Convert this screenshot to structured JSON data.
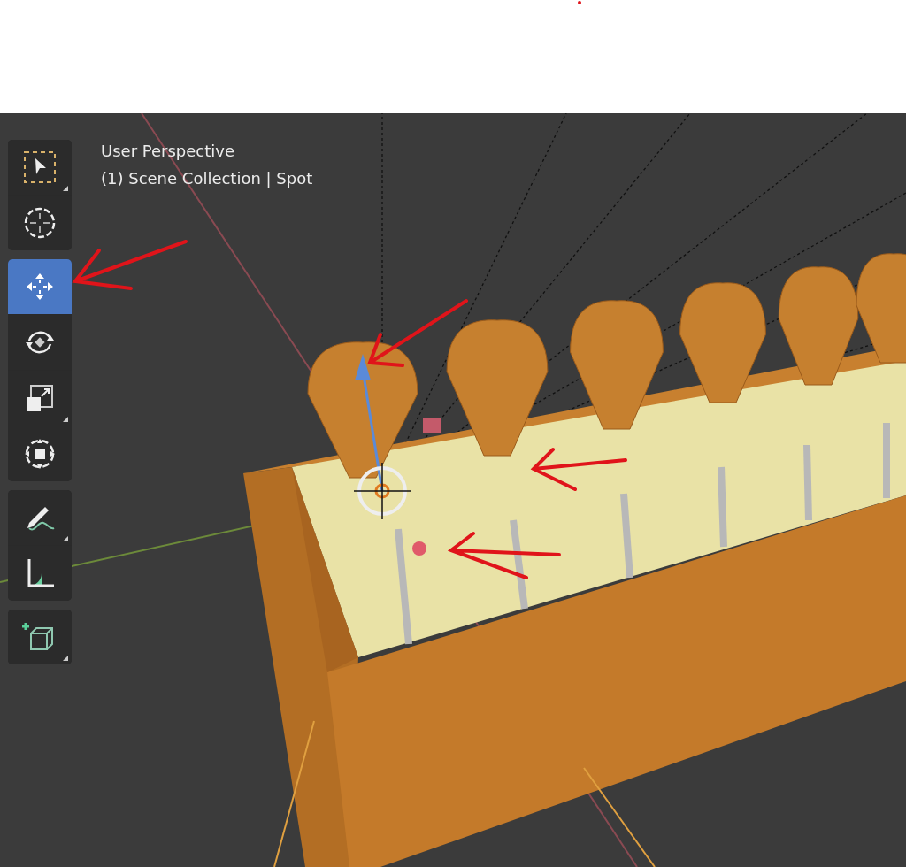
{
  "viewport": {
    "view_name": "User Perspective",
    "context": "(1) Scene Collection | Spot"
  },
  "toolbar": {
    "groups": [
      {
        "tools": [
          {
            "kind": "select",
            "selected": false,
            "submenu": true
          },
          {
            "kind": "cursor",
            "selected": false,
            "submenu": false
          }
        ]
      },
      {
        "tools": [
          {
            "kind": "move",
            "selected": true,
            "submenu": false
          },
          {
            "kind": "rotate",
            "selected": false,
            "submenu": false
          },
          {
            "kind": "scale",
            "selected": false,
            "submenu": true
          },
          {
            "kind": "transform",
            "selected": false,
            "submenu": false
          }
        ]
      },
      {
        "tools": [
          {
            "kind": "annotate",
            "selected": false,
            "submenu": true
          },
          {
            "kind": "measure",
            "selected": false,
            "submenu": false
          }
        ]
      },
      {
        "tools": [
          {
            "kind": "add_cube",
            "selected": false,
            "submenu": true
          }
        ]
      }
    ]
  }
}
